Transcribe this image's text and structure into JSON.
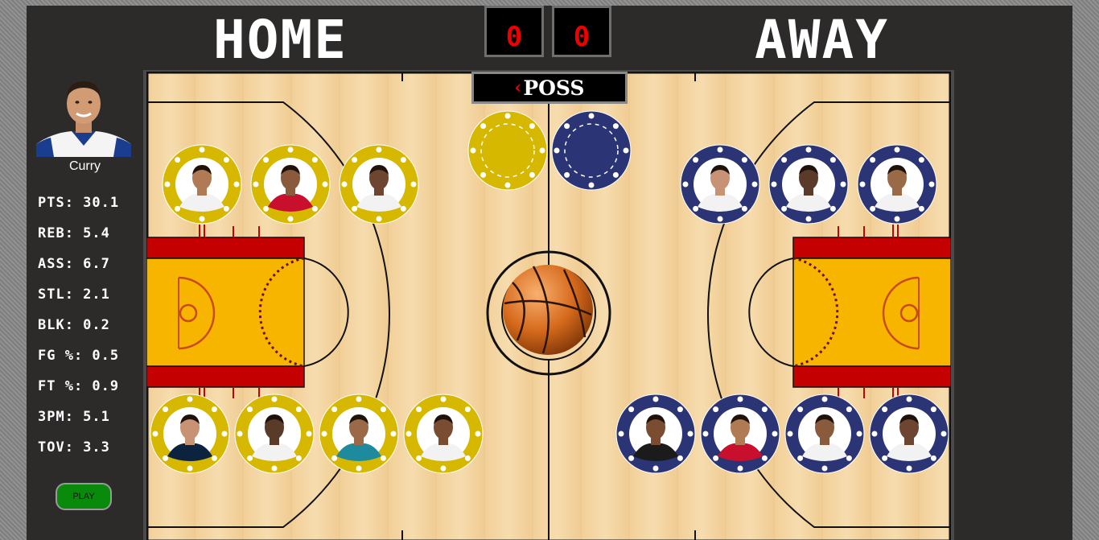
{
  "scoreboard": {
    "home_label": "HOME",
    "away_label": "AWAY",
    "home_score": "0",
    "away_score": "0",
    "possession_label": "POSS",
    "possession_arrow": "‹"
  },
  "selected_player": {
    "name": "Curry",
    "stats": [
      {
        "label": "PTS: 30.1"
      },
      {
        "label": "REB: 5.4"
      },
      {
        "label": "ASS: 6.7"
      },
      {
        "label": "STL: 2.1"
      },
      {
        "label": "BLK: 0.2"
      },
      {
        "label": "FG %: 0.5"
      },
      {
        "label": "FT %: 0.9"
      },
      {
        "label": "3PM: 5.1"
      },
      {
        "label": "TOV: 3.3"
      }
    ]
  },
  "play_button": {
    "label": "PLAY"
  },
  "colors": {
    "home_chip": "#d6b800",
    "away_chip": "#2b3475",
    "court_wood": "#f3d6a4",
    "paint_yellow": "#f7b500",
    "paint_red": "#c40000",
    "panel": "#2d2a2a",
    "play_green": "#0a8a0a",
    "score_digit": "#ee0000"
  },
  "home_chips_count": 7,
  "away_chips_count": 7
}
